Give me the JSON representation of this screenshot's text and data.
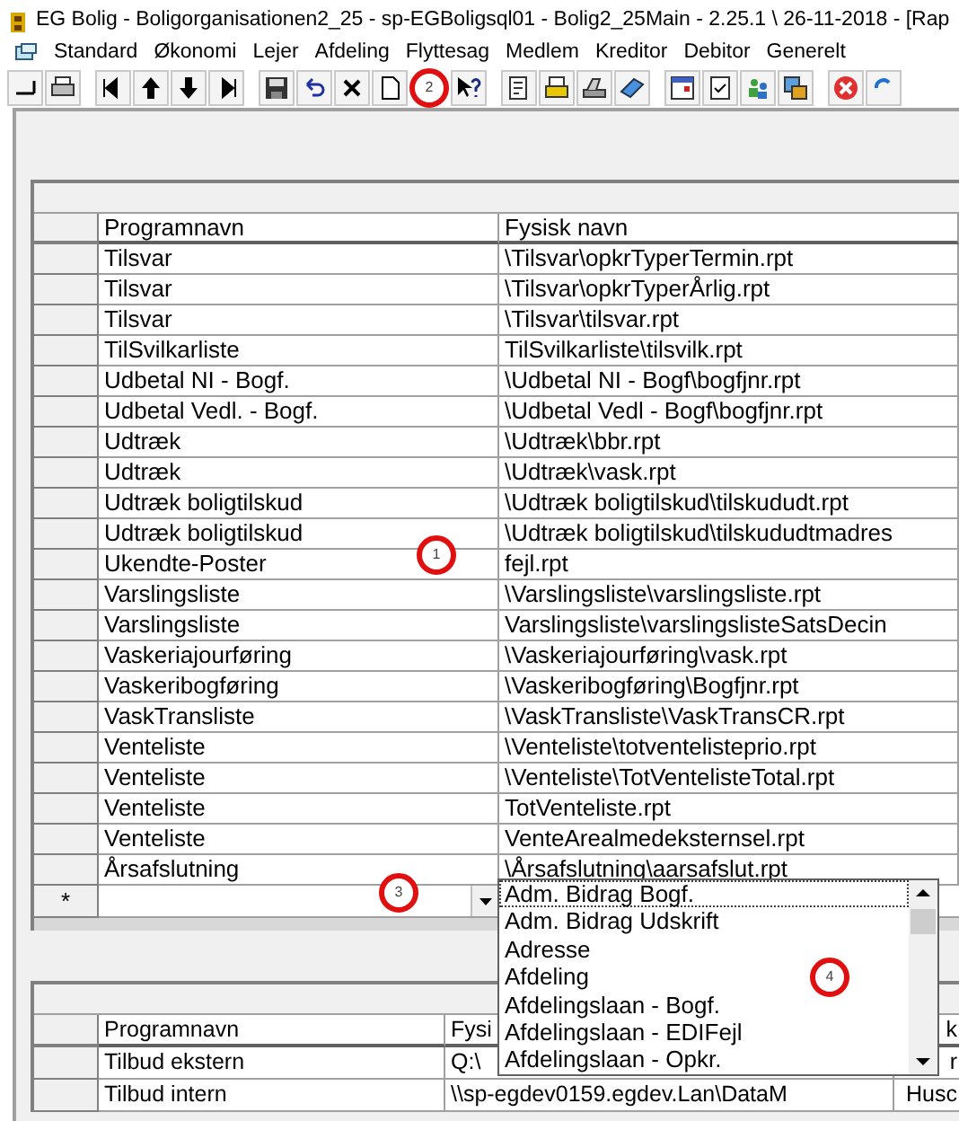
{
  "window": {
    "title": "EG Bolig  - Boligorganisationen2_25 - sp-EGBoligsql01 - Bolig2_25Main - 2.25.1 \\ 26-11-2018 - [Rap"
  },
  "menu": [
    {
      "label": "Standard"
    },
    {
      "label": "Økonomi"
    },
    {
      "label": "Lejer"
    },
    {
      "label": "Afdeling"
    },
    {
      "label": "Flyttesag"
    },
    {
      "label": "Medlem"
    },
    {
      "label": "Kreditor"
    },
    {
      "label": "Debitor"
    },
    {
      "label": "Generelt"
    }
  ],
  "toolbar_callout": "2",
  "top_grid": {
    "columns": [
      "Programnavn",
      "Fysisk navn"
    ],
    "rows": [
      [
        "Tilsvar",
        "\\Tilsvar\\opkrTyperTermin.rpt"
      ],
      [
        "Tilsvar",
        "\\Tilsvar\\opkrTyperÅrlig.rpt"
      ],
      [
        "Tilsvar",
        "\\Tilsvar\\tilsvar.rpt"
      ],
      [
        "TilSvilkarliste",
        "TilSvilkarliste\\tilsvilk.rpt"
      ],
      [
        "Udbetal NI - Bogf.",
        "\\Udbetal NI - Bogf\\bogfjnr.rpt"
      ],
      [
        "Udbetal Vedl. - Bogf.",
        "\\Udbetal Vedl - Bogf\\bogfjnr.rpt"
      ],
      [
        "Udtræk",
        "\\Udtræk\\bbr.rpt"
      ],
      [
        "Udtræk",
        "\\Udtræk\\vask.rpt"
      ],
      [
        "Udtræk boligtilskud",
        "\\Udtræk boligtilskud\\tilskududt.rpt"
      ],
      [
        "Udtræk boligtilskud",
        "\\Udtræk boligtilskud\\tilskududtmadres"
      ],
      [
        "Ukendte-Poster",
        "fejl.rpt"
      ],
      [
        "Varslingsliste",
        "\\Varslingsliste\\varslingsliste.rpt"
      ],
      [
        "Varslingsliste",
        "Varslingsliste\\varslingslisteSatsDecin"
      ],
      [
        "Vaskeriajourføring",
        "\\Vaskeriajourføring\\vask.rpt"
      ],
      [
        "Vaskeribogføring",
        "\\Vaskeribogføring\\Bogfjnr.rpt"
      ],
      [
        "VaskTransliste",
        "\\VaskTransliste\\VaskTransCR.rpt"
      ],
      [
        "Venteliste",
        "\\Venteliste\\totventelisteprio.rpt"
      ],
      [
        "Venteliste",
        "\\Venteliste\\TotVentelisteTotal.rpt"
      ],
      [
        "Venteliste",
        "TotVenteliste.rpt"
      ],
      [
        "Venteliste",
        "VenteArealmedeksternsel.rpt"
      ],
      [
        "Årsafslutning",
        "\\Årsafslutning\\aarsafslut.rpt"
      ]
    ],
    "new_row_marker": "*"
  },
  "dropdown": {
    "items": [
      {
        "label": "Adm. Bidrag Bogf.",
        "selected": true
      },
      {
        "label": "Adm. Bidrag Udskrift",
        "selected": false
      },
      {
        "label": "Adresse",
        "selected": false
      },
      {
        "label": "Afdeling",
        "selected": false
      },
      {
        "label": "Afdelingslaan - Bogf.",
        "selected": false
      },
      {
        "label": "Afdelingslaan - EDIFejl",
        "selected": false
      },
      {
        "label": "Afdelingslaan - Opkr.",
        "selected": false
      }
    ]
  },
  "bottom_grid": {
    "columns": [
      "Programnavn",
      "Fysi",
      "k"
    ],
    "rows": [
      [
        "Tilbud ekstern",
        "Q:\\",
        "r"
      ],
      [
        "Tilbud intern",
        "\\\\sp-egdev0159.egdev.Lan\\DataM",
        "Husc"
      ]
    ]
  },
  "callouts": [
    "1",
    "3",
    "4"
  ]
}
